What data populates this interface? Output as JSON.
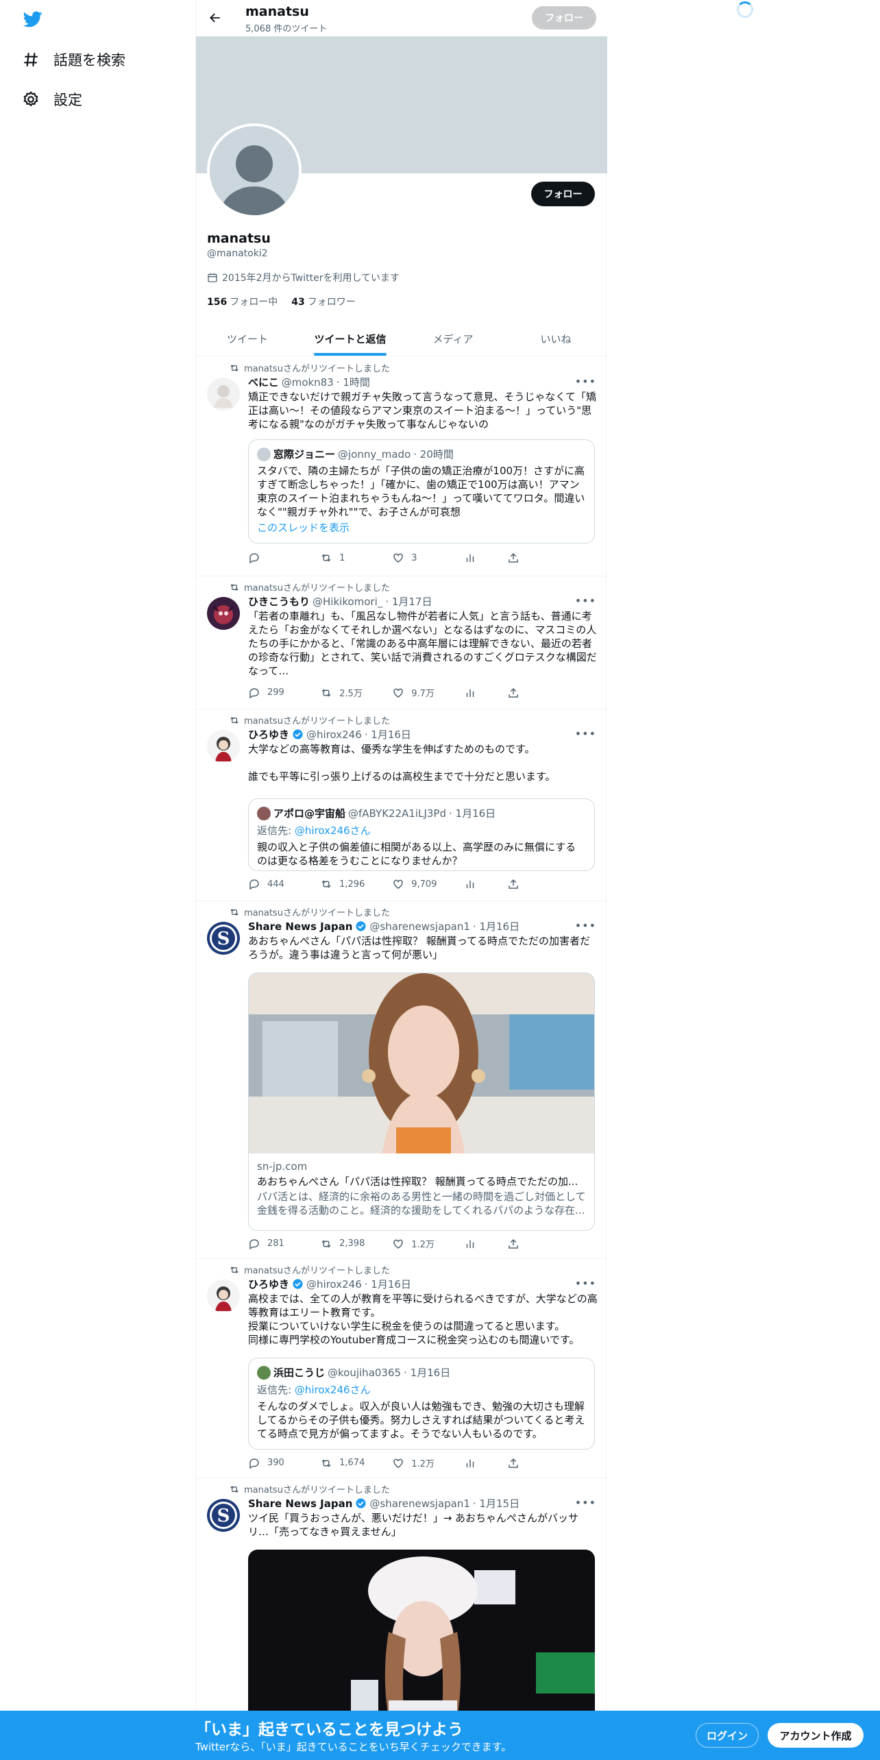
{
  "nav": {
    "explore_label": "話題を検索",
    "settings_label": "設定"
  },
  "header": {
    "name": "manatsu",
    "tweet_count": "5,068 件のツイート",
    "follow_label": "フォロー"
  },
  "profile": {
    "follow_label": "フォロー",
    "name": "manatsu",
    "handle": "@manatoki2",
    "joined": "2015年2月からTwitterを利用しています",
    "following_count": "156",
    "following_label": "フォロー中",
    "followers_count": "43",
    "followers_label": "フォロワー"
  },
  "tabs": [
    "ツイート",
    "ツイートと返信",
    "メディア",
    "いいね"
  ],
  "tweets": [
    {
      "retweeted_by": "manatsuさんがリツイートしました",
      "name": "べにこ",
      "handle": "@mokn83",
      "time": "· 1時間",
      "text": "矯正できないだけで親ガチャ失敗って言うなって意見、そうじゃなくて「矯正は高い〜！その値段ならアマン東京のスイート泊まる〜！」っていう\"思考になる親\"なのがガチャ失敗って事なんじゃないの",
      "quote": {
        "name": "窓際ジョニー",
        "handle": "@jonny_mado",
        "time": "· 20時間",
        "text": "スタバで、隣の主婦たちが「子供の歯の矯正治療が100万！さすがに高すぎて断念しちゃった！」「確かに、歯の矯正で100万は高い！アマン東京のスイート泊まれちゃうもんね〜！」って嘆いててワロタ。間違いなく\"\"親ガチャ外れ\"\"で、お子さんが可哀想",
        "link": "このスレッドを表示"
      },
      "replies": "",
      "retweets": "1",
      "likes": "3"
    },
    {
      "retweeted_by": "manatsuさんがリツイートしました",
      "name": "ひきこうもり",
      "handle": "@Hikikomori_",
      "time": "· 1月17日",
      "text": "「若者の車離れ」も、「風呂なし物件が若者に人気」と言う話も、普通に考えたら「お金がなくてそれしか選べない」となるはずなのに、マスコミの人たちの手にかかると、「常識のある中高年層には理解できない、最近の若者の珍奇な行動」とされて、笑い話で消費されるのすごくグロテスクな構図だなって…",
      "replies": "299",
      "retweets": "2.5万",
      "likes": "9.7万"
    },
    {
      "retweeted_by": "manatsuさんがリツイートしました",
      "name": "ひろゆき",
      "handle": "@hirox246",
      "time": "· 1月16日",
      "text": "大学などの高等教育は、優秀な学生を伸ばすためのものです。\n\n誰でも平等に引っ張り上げるのは高校生までで十分だと思います。",
      "quote": {
        "name": "アポロ@宇宙船",
        "handle": "@fABYK22A1iLJ3Pd",
        "time": "· 1月16日",
        "reply_label": "返信先:",
        "reply_to": "@hirox246さん",
        "text": "親の収入と子供の偏差値に相関がある以上、高学歴のみに無償にするのは更なる格差をうむことになりませんか？"
      },
      "replies": "444",
      "retweets": "1,296",
      "likes": "9,709"
    },
    {
      "retweeted_by": "manatsuさんがリツイートしました",
      "name": "Share News Japan",
      "handle": "@sharenewsjapan1",
      "time": "· 1月16日",
      "text": "あおちゃんぺさん「パパ活は性搾取？ 報酬貰ってる時点でただの加害者だろうが。違う事は違うと言って何が悪い」",
      "card": {
        "domain": "sn-jp.com",
        "title": "あおちゃんぺさん「パパ活は性搾取？ 報酬貰ってる時点でただの加...",
        "desc": "パパ活とは、経済的に余裕のある男性と一緒の時間を過ごし対価として金銭を得る活動のこと。経済的な援助をしてくれるパパのような存在..."
      },
      "replies": "281",
      "retweets": "2,398",
      "likes": "1.2万"
    },
    {
      "retweeted_by": "manatsuさんがリツイートしました",
      "name": "ひろゆき",
      "handle": "@hirox246",
      "time": "· 1月16日",
      "text": "高校までは、全ての人が教育を平等に受けられるべきですが、大学などの高等教育はエリート教育です。\n授業についていけない学生に税金を使うのは間違ってると思います。\n同様に専門学校のYoutuber育成コースに税金突っ込むのも間違いです。",
      "quote": {
        "name": "浜田こうじ",
        "handle": "@koujiha0365",
        "time": "· 1月16日",
        "reply_label": "返信先:",
        "reply_to": "@hirox246さん",
        "text": "そんなのダメでしょ。収入が良い人は勉強もでき、勉強の大切さも理解してるからその子供も優秀。努力しさえすれば結果がついてくると考えてる時点で見方が偏ってますよ。そうでない人もいるのです。"
      },
      "replies": "390",
      "retweets": "1,674",
      "likes": "1.2万"
    },
    {
      "retweeted_by": "manatsuさんがリツイートしました",
      "name": "Share News Japan",
      "handle": "@sharenewsjapan1",
      "time": "· 1月15日",
      "text": "ツイ民「買うおっさんが、悪いだけだ！」→ あおちゃんぺさんがバッサリ…「売ってなきゃ買えません」"
    }
  ],
  "bottom_bar": {
    "title": "「いま」起きていることを見つけよう",
    "subtitle": "Twitterなら、「いま」起きていることをいち早くチェックできます。",
    "login_label": "ログイン",
    "signup_label": "アカウント作成"
  },
  "colors": {
    "accent": "#1d9bf0",
    "text": "#0f1419",
    "muted": "#536471"
  }
}
